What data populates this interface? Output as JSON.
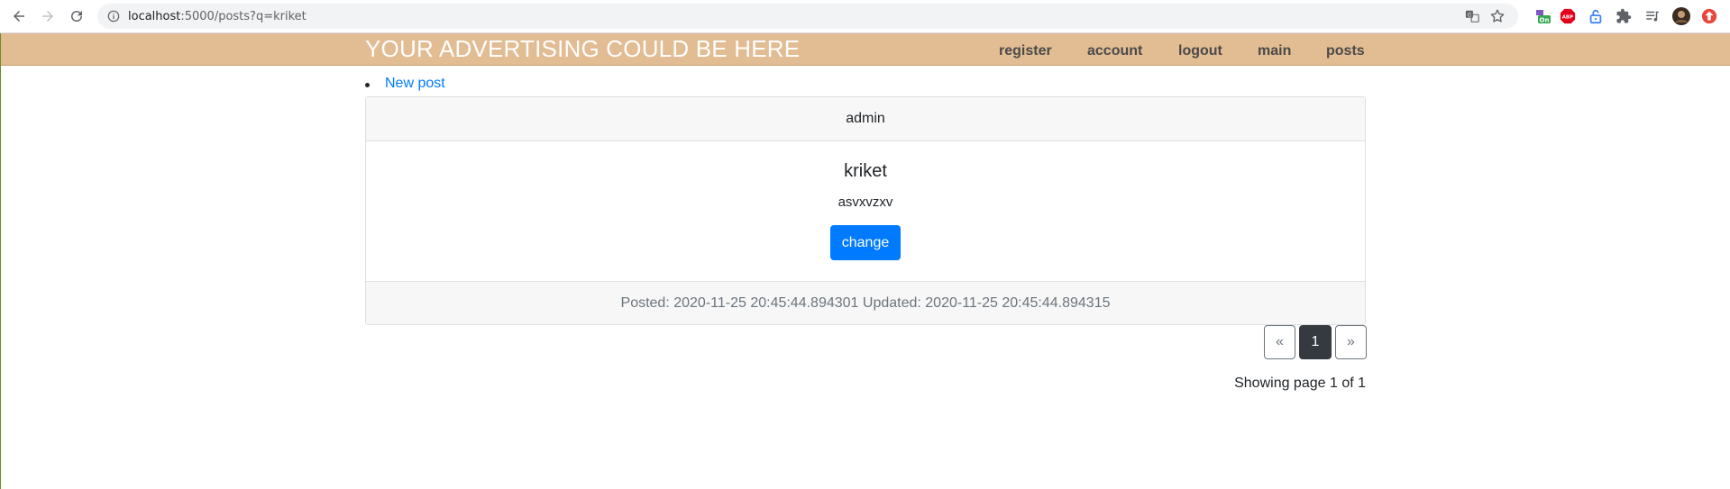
{
  "browser": {
    "url_host": "localhost",
    "url_path": ":5000/posts?q=kriket",
    "extensions": [
      {
        "name": "ext-on-icon",
        "color": "#34a853"
      },
      {
        "name": "adblock-icon",
        "color": "#e3001b"
      },
      {
        "name": "lock-ext-icon",
        "color": "#4285f4"
      },
      {
        "name": "puzzle-icon",
        "color": "#5f6368"
      },
      {
        "name": "queue-icon",
        "color": "#5f6368"
      },
      {
        "name": "avatar",
        "color": "#7a5a3c"
      },
      {
        "name": "update-icon",
        "color": "#e8453c"
      }
    ]
  },
  "header": {
    "brand": "YOUR ADVERTISING COULD BE HERE",
    "nav": {
      "register": "register",
      "account": "account",
      "logout": "logout",
      "main": "main",
      "posts": "posts"
    },
    "background": "#e2bc92"
  },
  "main": {
    "new_post_link": "New post",
    "post": {
      "author": "admin",
      "title": "kriket",
      "body": "asvxvzxv",
      "button": "change",
      "footer": "Posted: 2020-11-25 20:45:44.894301 Updated: 2020-11-25 20:45:44.894315"
    },
    "pagination": {
      "prev": "«",
      "current": "1",
      "next": "»",
      "summary": "Showing page 1 of 1"
    }
  }
}
